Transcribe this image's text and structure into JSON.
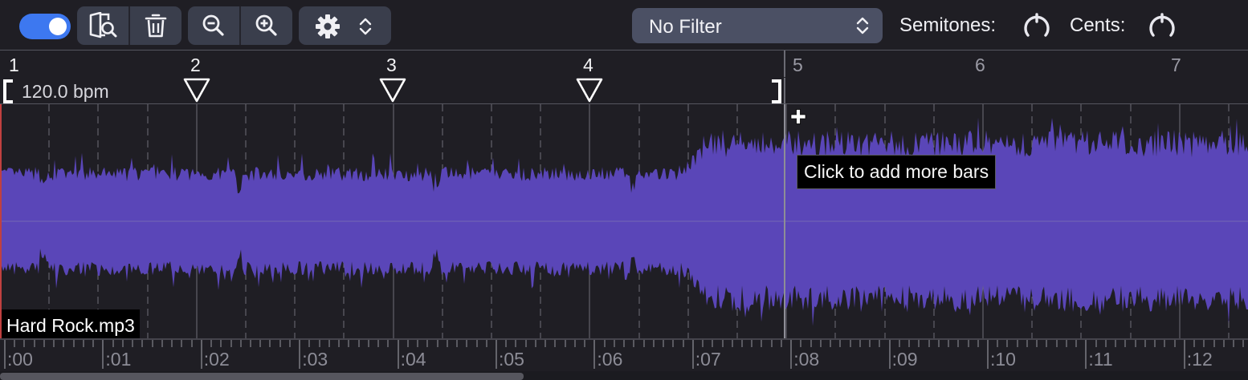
{
  "toolbar": {
    "toggle_on": true,
    "buttons": [
      "find-in-library-icon",
      "trash-icon",
      "zoom-out-icon",
      "zoom-in-icon",
      "gear-icon",
      "updown-chevron-icon"
    ],
    "filter_label": "No Filter",
    "semitones_label": "Semitones:",
    "cents_label": "Cents:"
  },
  "ruler": {
    "bars": [
      "1",
      "2",
      "3",
      "4",
      "5",
      "6",
      "7"
    ]
  },
  "tempo": {
    "bpm_label": "120.0 bpm"
  },
  "track": {
    "file_name": "Hard Rock.mp3"
  },
  "tooltip": {
    "text": "Click to add more bars"
  },
  "timeline": {
    "labels": [
      ":00",
      ":01",
      ":02",
      ":03",
      ":04",
      ":05",
      ":06",
      ":07",
      ":08",
      ":09",
      ":10",
      ":11",
      ":12"
    ]
  },
  "colors": {
    "background": "#1f1e24",
    "waveform": "#5a46b8",
    "accent": "#3d78f0",
    "playhead": "#c04040"
  }
}
